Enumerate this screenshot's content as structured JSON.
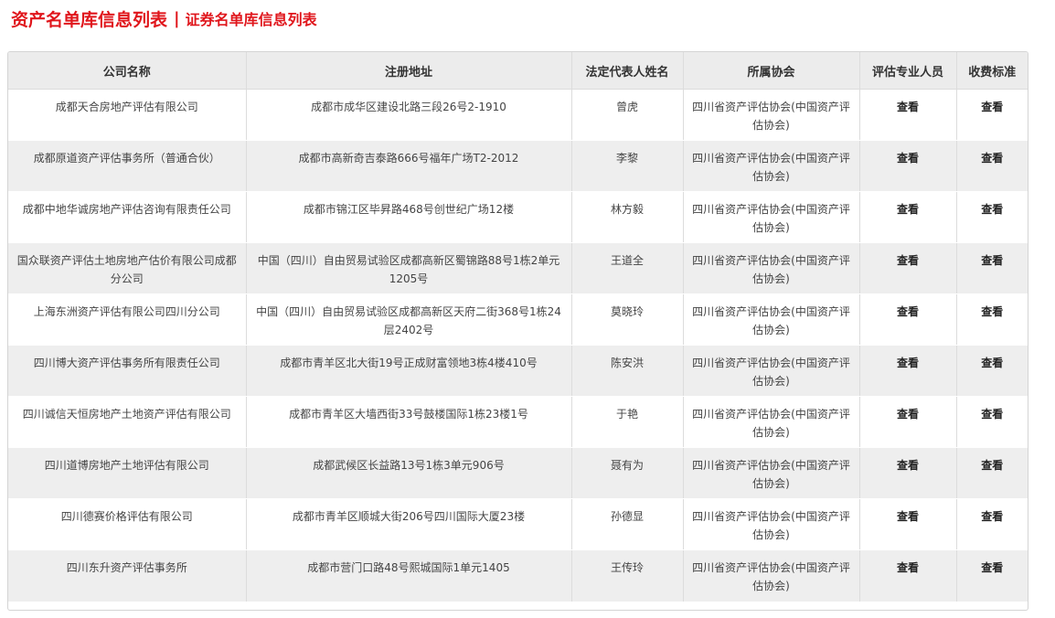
{
  "header": {
    "active_title": "资产名单库信息列表",
    "separator": "|",
    "other_title": "证券名单库信息列表"
  },
  "table": {
    "columns": [
      "公司名称",
      "注册地址",
      "法定代表人姓名",
      "所属协会",
      "评估专业人员",
      "收费标准"
    ],
    "rows": [
      {
        "company": "成都天合房地产评估有限公司",
        "address": "成都市成华区建设北路三段26号2-1910",
        "rep": "曾虎",
        "association": "四川省资产评估协会(中国资产评估协会)",
        "staff": "查看",
        "fee": "查看"
      },
      {
        "company": "成都原道资产评估事务所（普通合伙）",
        "address": "成都市高新奇吉泰路666号福年广场T2-2012",
        "rep": "李黎",
        "association": "四川省资产评估协会(中国资产评估协会)",
        "staff": "查看",
        "fee": "查看"
      },
      {
        "company": "成都中地华诚房地产评估咨询有限责任公司",
        "address": "成都市锦江区毕昇路468号创世纪广场12楼",
        "rep": "林方毅",
        "association": "四川省资产评估协会(中国资产评估协会)",
        "staff": "查看",
        "fee": "查看"
      },
      {
        "company": "国众联资产评估土地房地产估价有限公司成都分公司",
        "address": "中国（四川）自由贸易试验区成都高新区蜀锦路88号1栋2单元1205号",
        "rep": "王道全",
        "association": "四川省资产评估协会(中国资产评估协会)",
        "staff": "查看",
        "fee": "查看"
      },
      {
        "company": "上海东洲资产评估有限公司四川分公司",
        "address": "中国（四川）自由贸易试验区成都高新区天府二街368号1栋24层2402号",
        "rep": "莫晓玲",
        "association": "四川省资产评估协会(中国资产评估协会)",
        "staff": "查看",
        "fee": "查看"
      },
      {
        "company": "四川博大资产评估事务所有限责任公司",
        "address": "成都市青羊区北大街19号正成财富领地3栋4楼410号",
        "rep": "陈安洪",
        "association": "四川省资产评估协会(中国资产评估协会)",
        "staff": "查看",
        "fee": "查看"
      },
      {
        "company": "四川诚信天恒房地产土地资产评估有限公司",
        "address": "成都市青羊区大墙西街33号鼓楼国际1栋23楼1号",
        "rep": "于艳",
        "association": "四川省资产评估协会(中国资产评估协会)",
        "staff": "查看",
        "fee": "查看"
      },
      {
        "company": "四川道博房地产土地评估有限公司",
        "address": "成都武候区长益路13号1栋3单元906号",
        "rep": "聂有为",
        "association": "四川省资产评估协会(中国资产评估协会)",
        "staff": "查看",
        "fee": "查看"
      },
      {
        "company": "四川德赛价格评估有限公司",
        "address": "成都市青羊区顺城大街206号四川国际大厦23楼",
        "rep": "孙德显",
        "association": "四川省资产评估协会(中国资产评估协会)",
        "staff": "查看",
        "fee": "查看"
      },
      {
        "company": "四川东升资产评估事务所",
        "address": "成都市营门口路48号熙城国际1单元1405",
        "rep": "王传玲",
        "association": "四川省资产评估协会(中国资产评估协会)",
        "staff": "查看",
        "fee": "查看"
      }
    ]
  }
}
